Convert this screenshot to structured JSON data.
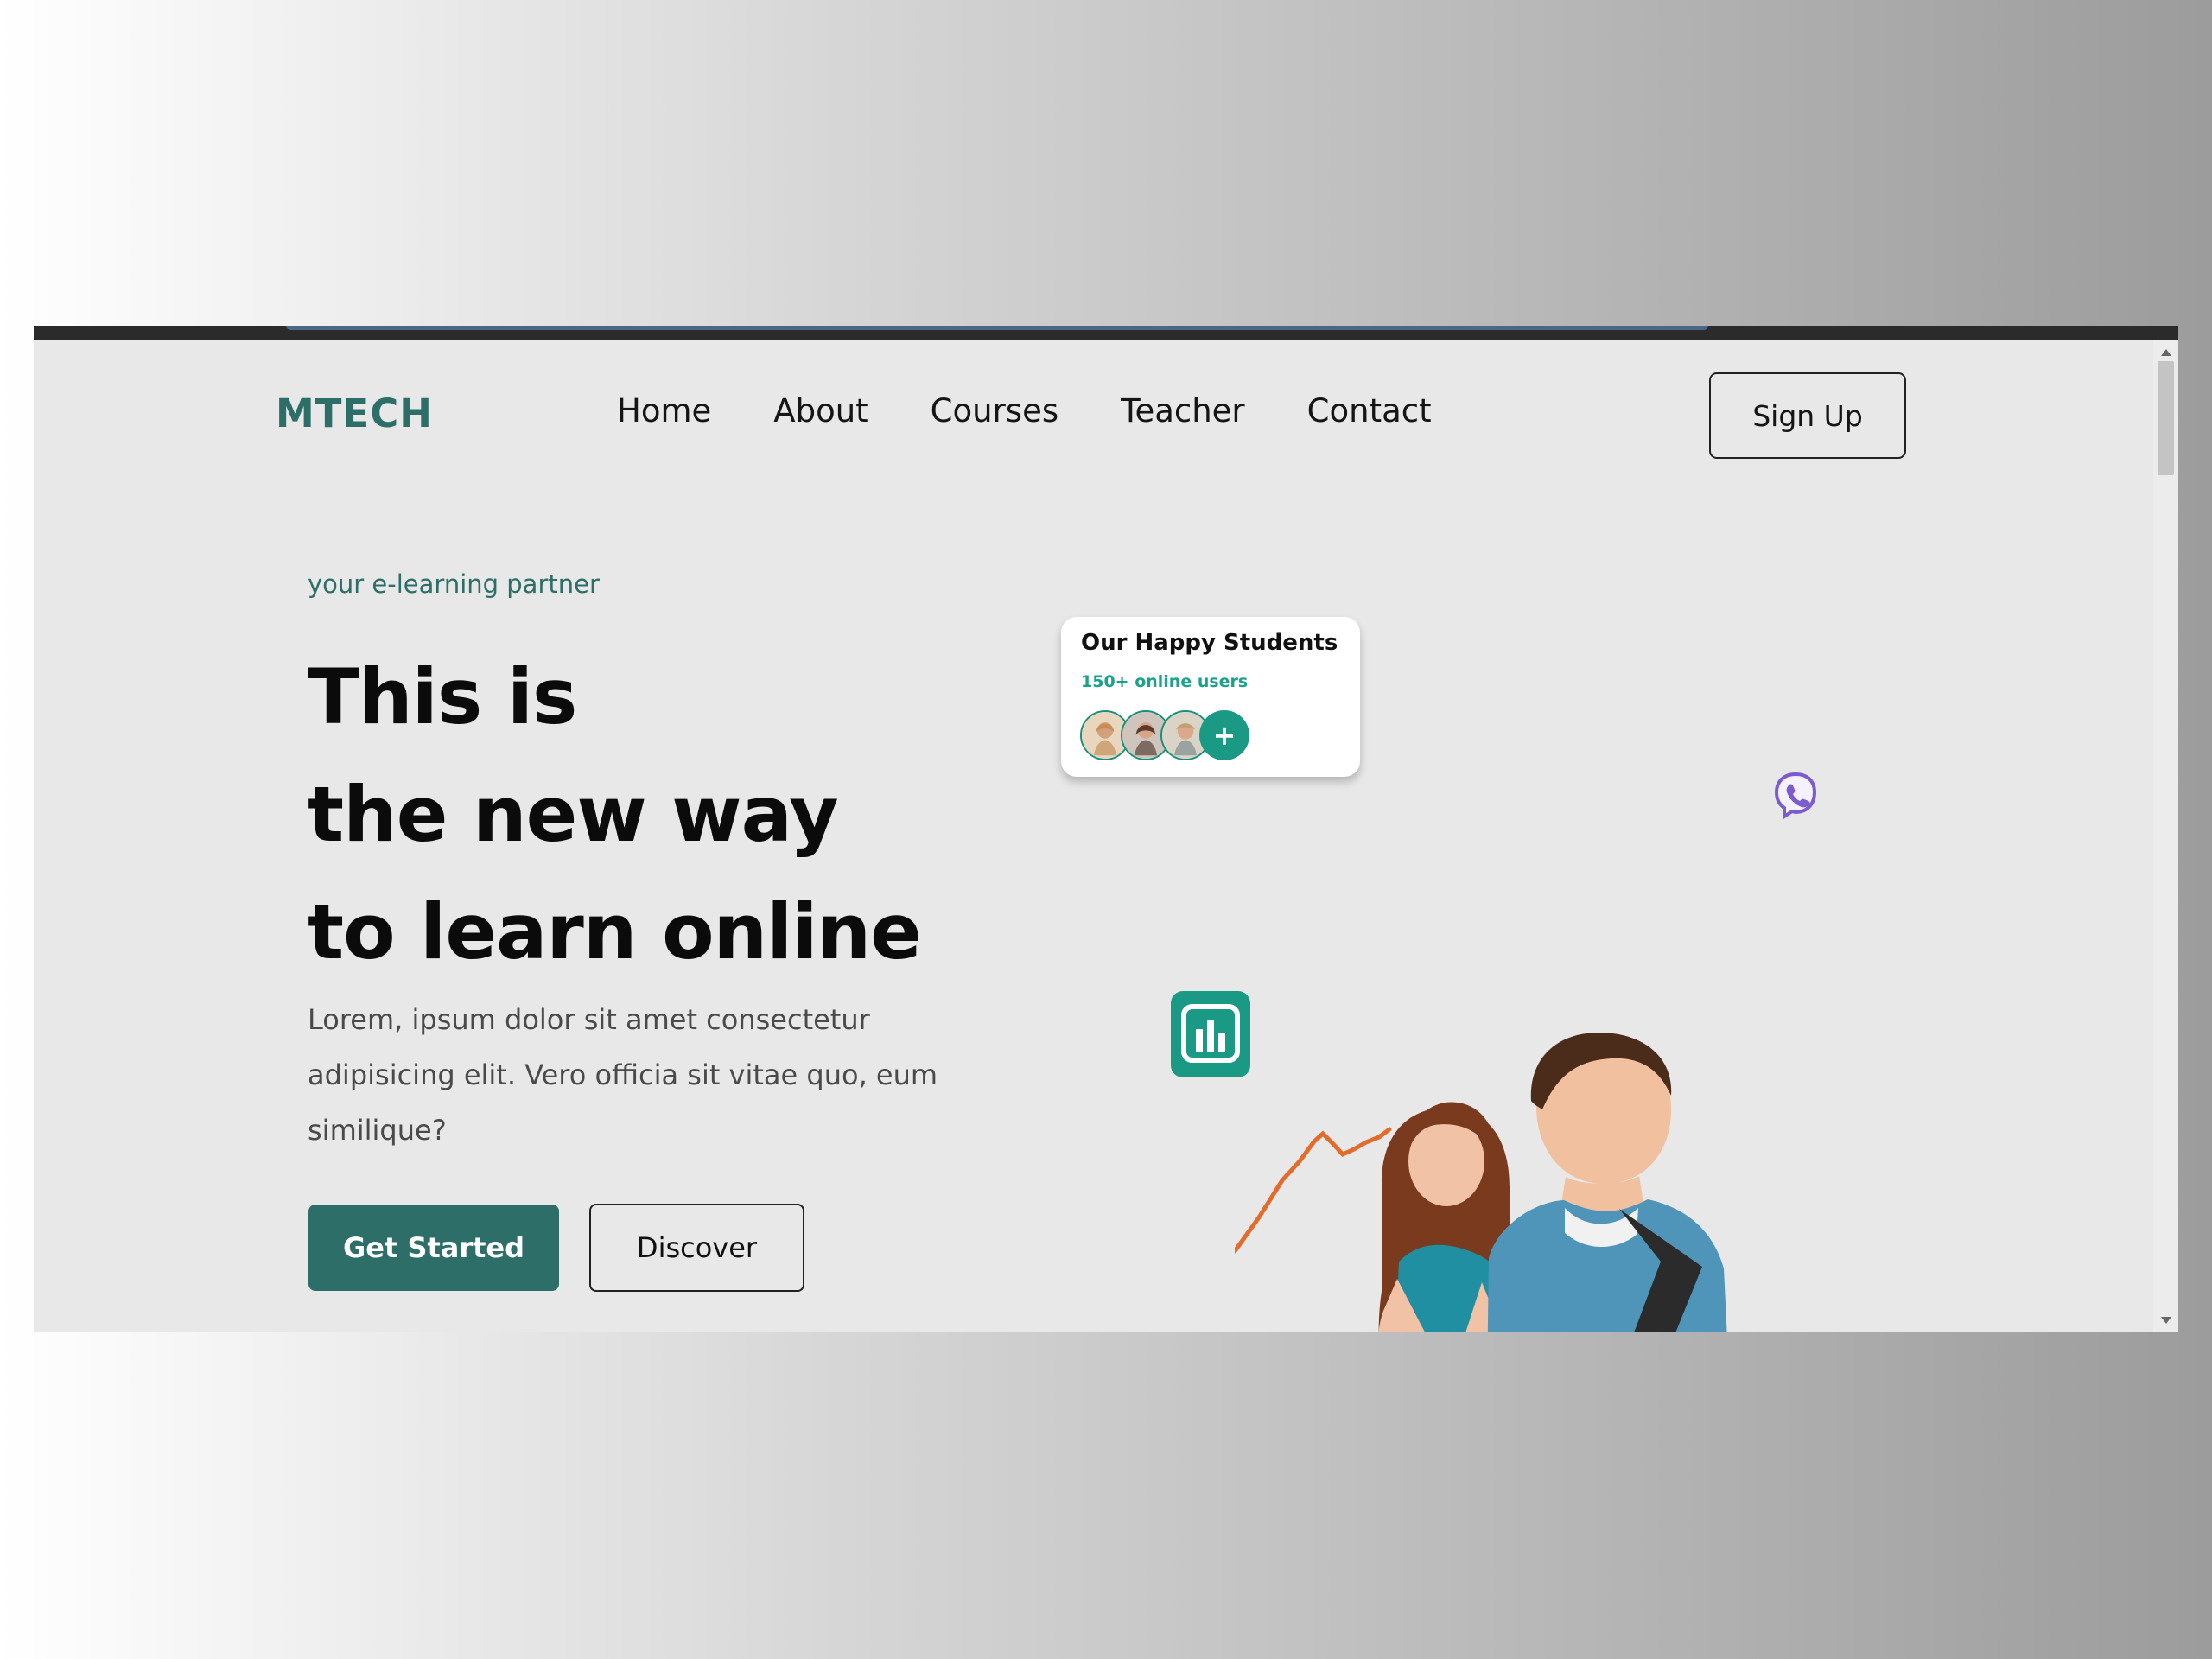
{
  "nav": {
    "logo": "MTECH",
    "links": [
      "Home",
      "About",
      "Courses",
      "Teacher",
      "Contact"
    ],
    "signup": "Sign Up"
  },
  "hero": {
    "tagline": "your e-learning partner",
    "headline_lines": [
      "This is",
      "the new way",
      "to learn online"
    ],
    "description": "Lorem, ipsum dolor sit amet consectetur adipisicing elit. Vero officia sit vitae quo, eum similique?",
    "primary_cta": "Get Started",
    "secondary_cta": "Discover"
  },
  "students_card": {
    "title": "Our Happy Students",
    "subtitle": "150+ online users",
    "plus": "+"
  },
  "icons": [
    "chart-icon",
    "viber-icon",
    "plus-icon"
  ],
  "colors": {
    "brand": "#2e6e68",
    "accent": "#1aa28a",
    "viber": "#7b5ccf"
  }
}
